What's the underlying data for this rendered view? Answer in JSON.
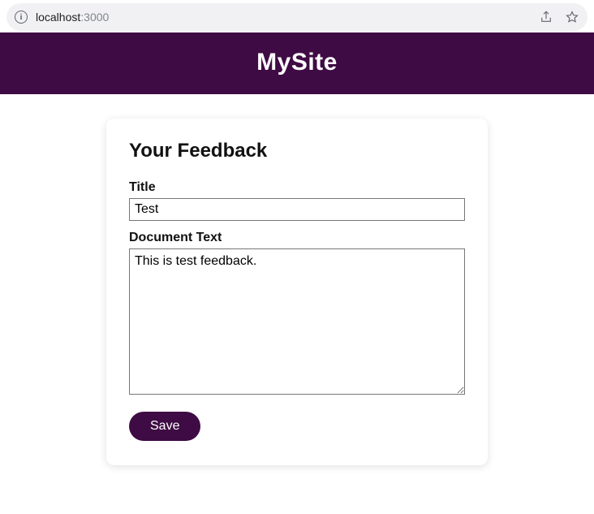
{
  "browser": {
    "url_host": "localhost",
    "url_port": ":3000"
  },
  "header": {
    "title": "MySite"
  },
  "form": {
    "heading": "Your Feedback",
    "title_label": "Title",
    "title_value": "Test",
    "body_label": "Document Text",
    "body_value": "This is test feedback.",
    "save_label": "Save"
  }
}
